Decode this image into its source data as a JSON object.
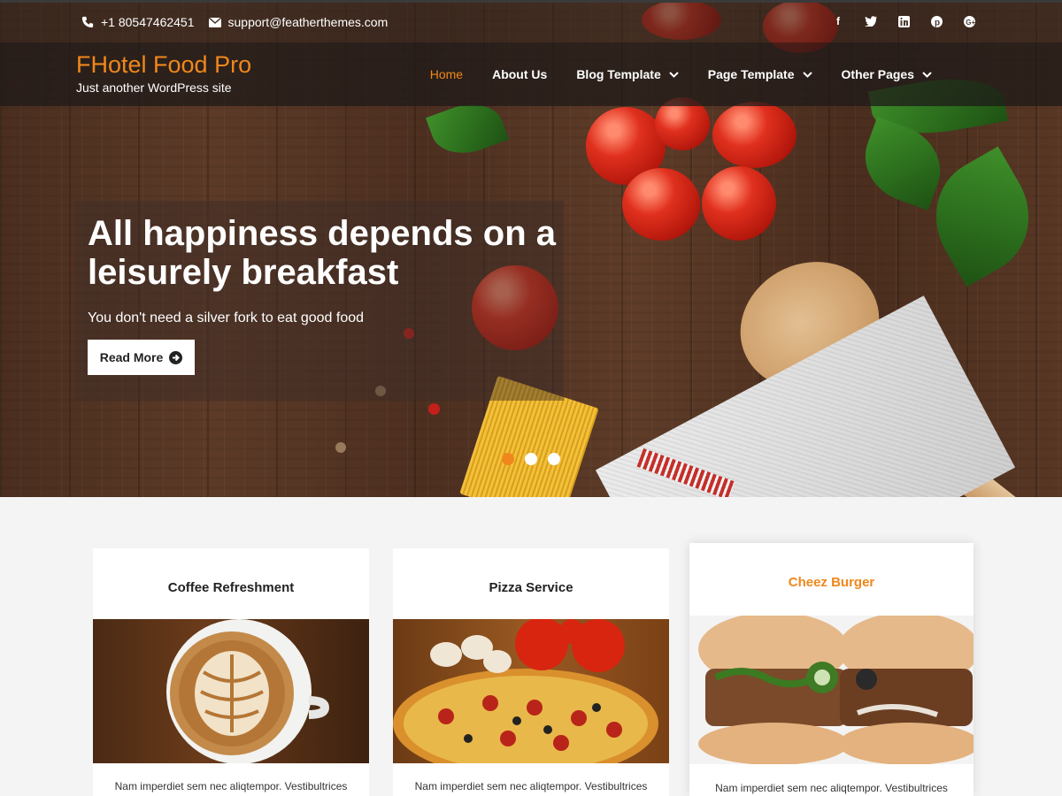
{
  "topbar": {
    "phone": "+1 80547462451",
    "email": "support@featherthemes.com",
    "social_icons": [
      "facebook-icon",
      "twitter-icon",
      "linkedin-icon",
      "pinterest-icon",
      "google-plus-icon"
    ]
  },
  "header": {
    "site_title": "FHotel Food Pro",
    "tagline": "Just another WordPress site",
    "menu": [
      {
        "label": "Home",
        "active": true
      },
      {
        "label": "About Us"
      },
      {
        "label": "Blog Template",
        "dropdown": true
      },
      {
        "label": "Page Template",
        "dropdown": true
      },
      {
        "label": "Other Pages",
        "dropdown": true
      }
    ]
  },
  "hero": {
    "title": "All happiness depends on a leisurely breakfast",
    "subtitle": "You don't need a silver fork to eat good food",
    "button_label": "Read More",
    "slides": 3,
    "active_slide": 1
  },
  "cards": [
    {
      "title": "Coffee Refreshment",
      "text": "Nam imperdiet sem nec aliqtempor. Vestibultrices"
    },
    {
      "title": "Pizza Service",
      "text": "Nam imperdiet sem nec aliqtempor. Vestibultrices"
    },
    {
      "title": "Cheez Burger",
      "text": "Nam imperdiet sem nec aliqtempor. Vestibultrices"
    }
  ],
  "colors": {
    "accent": "#f0871c",
    "text": "#222222",
    "background": "#f4f4f4"
  }
}
